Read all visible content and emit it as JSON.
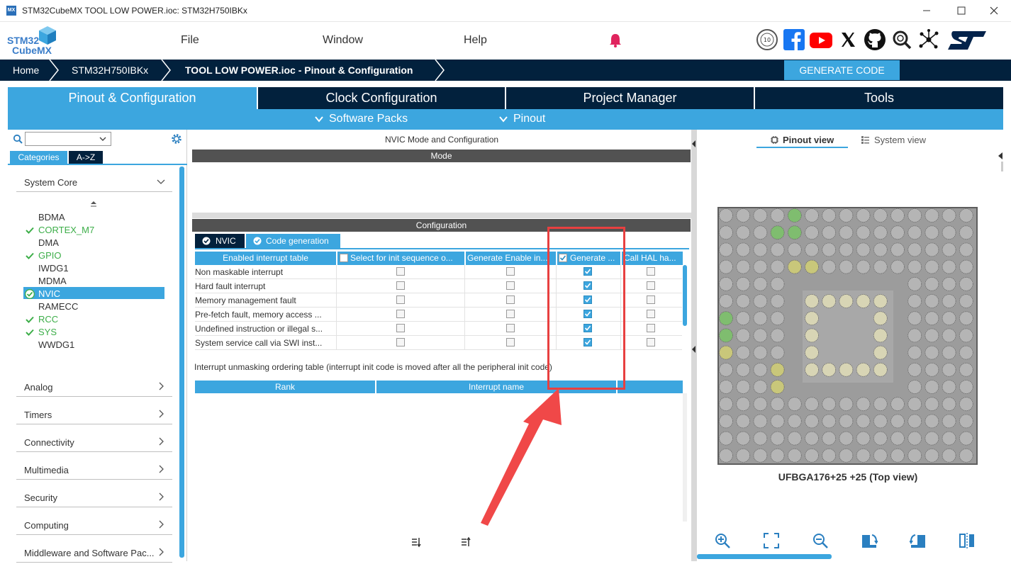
{
  "window": {
    "app_icon": "MX",
    "title": "STM32CubeMX TOOL LOW POWER.ioc: STM32H750IBKx"
  },
  "logo": {
    "line1": "STM32",
    "line2": "CubeMX"
  },
  "menu": {
    "file": "File",
    "window": "Window",
    "help": "Help"
  },
  "social_icons": [
    "10-years-badge-icon",
    "facebook-icon",
    "youtube-icon",
    "x-icon",
    "github-icon",
    "community-icon",
    "network-icon",
    "st-logo-icon"
  ],
  "breadcrumb": {
    "home": "Home",
    "device": "STM32H750IBKx",
    "current": "TOOL LOW POWER.ioc - Pinout & Configuration",
    "generate": "GENERATE CODE"
  },
  "tabs": {
    "pinout": "Pinout & Configuration",
    "clock": "Clock Configuration",
    "project": "Project Manager",
    "tools": "Tools"
  },
  "subbar": {
    "software_packs": "Software Packs",
    "pinout": "Pinout"
  },
  "left": {
    "categories_tab": "Categories",
    "az_tab": "A->Z",
    "system_core": "System Core",
    "system_core_items": [
      {
        "label": "BDMA",
        "ok": false
      },
      {
        "label": "CORTEX_M7",
        "ok": true
      },
      {
        "label": "DMA",
        "ok": false
      },
      {
        "label": "GPIO",
        "ok": true
      },
      {
        "label": "IWDG1",
        "ok": false
      },
      {
        "label": "MDMA",
        "ok": false
      },
      {
        "label": "NVIC",
        "ok": true,
        "selected": true
      },
      {
        "label": "RAMECC",
        "ok": false
      },
      {
        "label": "RCC",
        "ok": true
      },
      {
        "label": "SYS",
        "ok": true
      },
      {
        "label": "WWDG1",
        "ok": false
      }
    ],
    "categories": [
      "Analog",
      "Timers",
      "Connectivity",
      "Multimedia",
      "Security",
      "Computing",
      "Middleware and Software Pac..."
    ]
  },
  "middle": {
    "title": "NVIC Mode and Configuration",
    "mode": "Mode",
    "configuration": "Configuration",
    "tab_nvic": "NVIC",
    "tab_codegen": "Code generation",
    "columns": [
      "Enabled interrupt table",
      "Select for init sequence o...",
      "Generate Enable in...",
      "Generate ...",
      "Call HAL ha..."
    ],
    "rows": [
      {
        "name": "Non maskable interrupt",
        "checks": [
          false,
          false,
          true,
          false
        ]
      },
      {
        "name": "Hard fault interrupt",
        "checks": [
          false,
          false,
          true,
          false
        ]
      },
      {
        "name": "Memory management fault",
        "checks": [
          false,
          false,
          true,
          false
        ]
      },
      {
        "name": "Pre-fetch fault, memory access ...",
        "checks": [
          false,
          false,
          true,
          false
        ]
      },
      {
        "name": "Undefined instruction or illegal s...",
        "checks": [
          false,
          false,
          true,
          false
        ]
      },
      {
        "name": "System service call via SWI inst...",
        "checks": [
          false,
          false,
          true,
          false
        ]
      }
    ],
    "unmask_text": "Interrupt unmasking ordering table (interrupt init code is moved after all the peripheral init code)",
    "rank": "Rank",
    "interrupt_name": "Interrupt name"
  },
  "right": {
    "pinout_view": "Pinout view",
    "system_view": "System view",
    "chip_label": "UFBGA176+25 +25 (Top view)"
  },
  "colors": {
    "accent": "#3ca6df",
    "navy": "#02213d",
    "ok_green": "#3dae49",
    "annotation_red": "#e84040"
  }
}
